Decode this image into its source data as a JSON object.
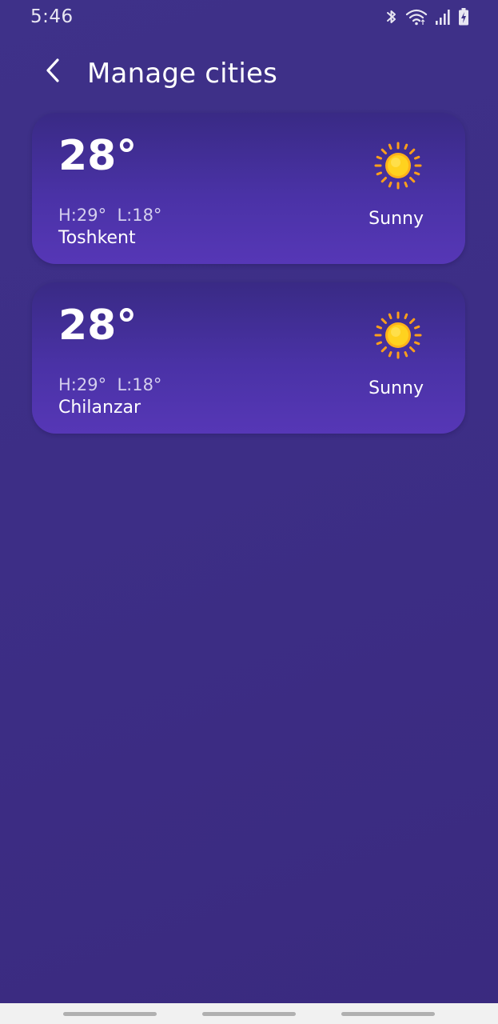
{
  "status_bar": {
    "time": "5:46",
    "icons": [
      "bluetooth-icon",
      "wifi-icon",
      "signal-icon",
      "battery-charging-icon"
    ]
  },
  "header": {
    "back_icon": "chevron-left-icon",
    "title": "Manage cities"
  },
  "cities": [
    {
      "temp": "28°",
      "hilo": "H:29°  L:18°",
      "name": "Toshkent",
      "condition": "Sunny",
      "icon": "sun-icon"
    },
    {
      "temp": "28°",
      "hilo": "H:29°  L:18°",
      "name": "Chilanzar",
      "condition": "Sunny",
      "icon": "sun-icon"
    }
  ],
  "colors": {
    "background": "#3d2e86",
    "card_top": "#392a85",
    "card_bottom": "#5637b6",
    "sun_core": "#ffd21f",
    "sun_rays": "#ff9f1a",
    "nav_bar": "#f1f1f1"
  }
}
